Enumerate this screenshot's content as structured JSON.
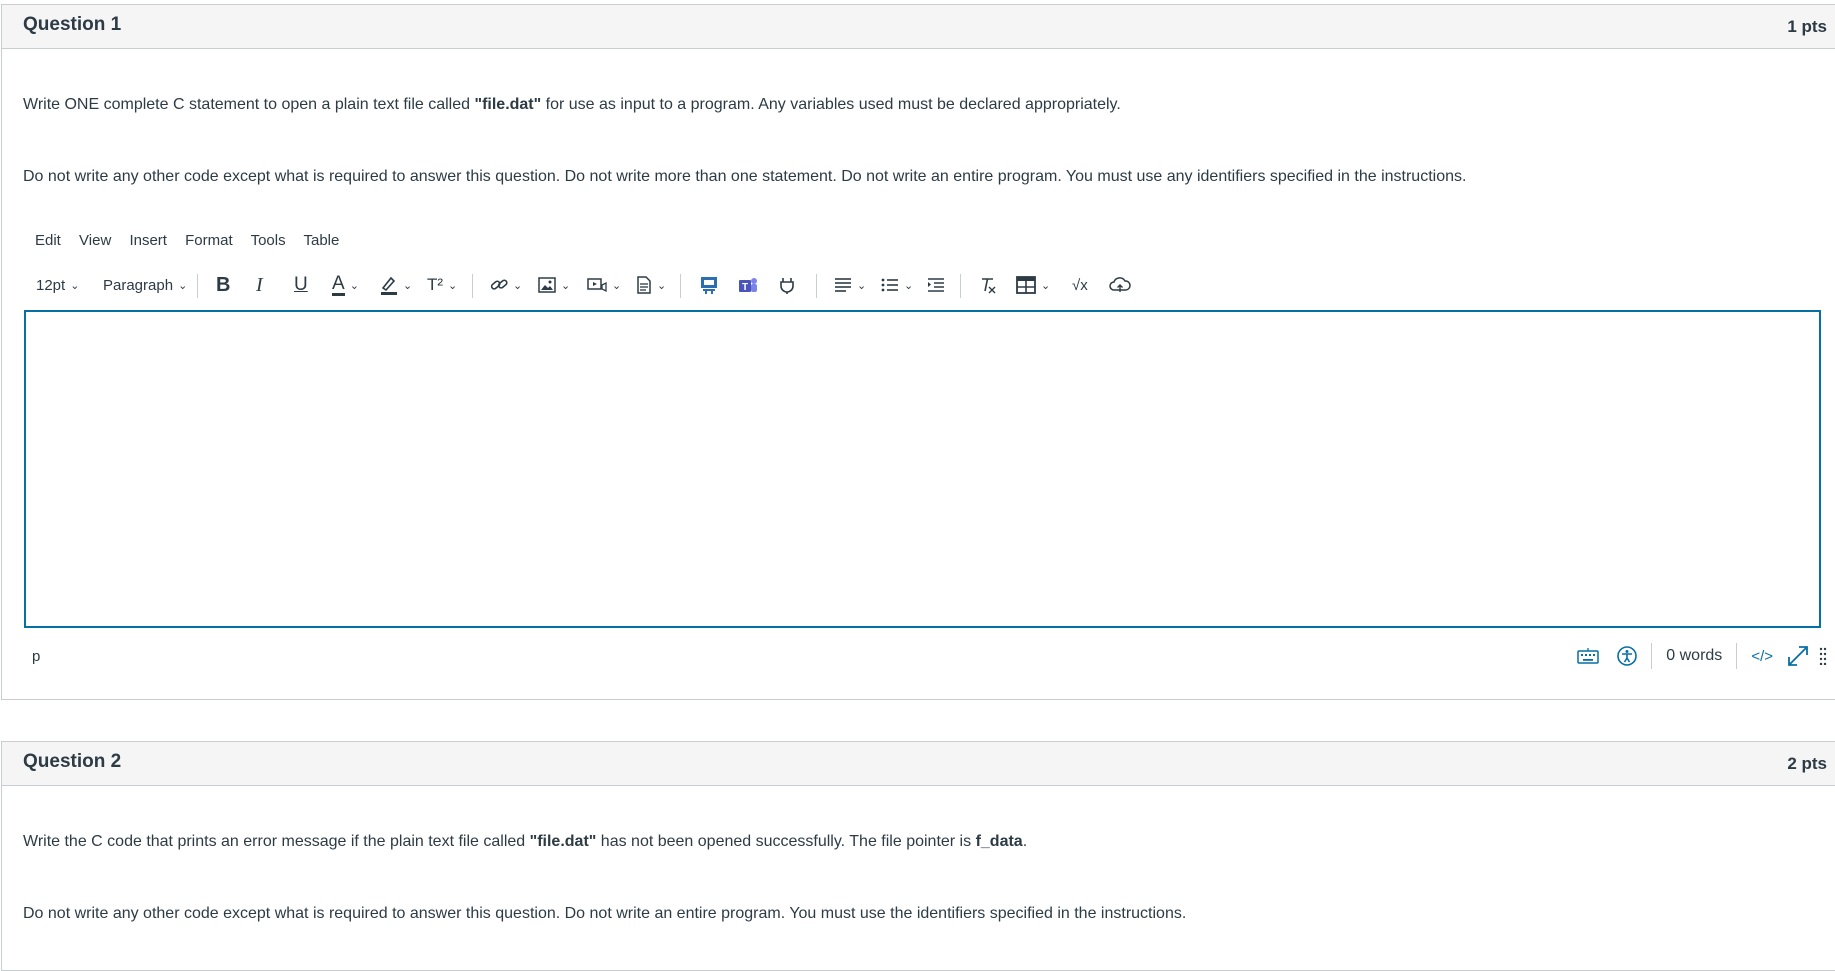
{
  "questions": [
    {
      "title": "Question 1",
      "points": "1 pts",
      "para1": {
        "before": "Write ONE complete C statement to open a plain text file called ",
        "bold": "\"file.dat\"",
        "after": " for use as input to a program. Any variables used must be declared appropriately."
      },
      "para2": "Do not write any other code except what is required to answer this question. Do not write more than one statement. Do not write an entire program. You must use any identifiers specified in the instructions."
    },
    {
      "title": "Question 2",
      "points": "2 pts",
      "para1": {
        "before": "Write the C code that prints an error message if the plain text file called ",
        "bold": "\"file.dat\"",
        "middle": " has not been opened successfully. The file pointer is ",
        "bold2": "f_data",
        "after": "."
      },
      "para2": "Do not write any other code except what is required to answer this question. Do not write an entire program. You must use the identifiers specified in the instructions."
    }
  ],
  "editor": {
    "menu": [
      "Edit",
      "View",
      "Insert",
      "Format",
      "Tools",
      "Table"
    ],
    "font_size": "12pt",
    "block_format": "Paragraph",
    "content": "",
    "status_path": "p",
    "word_count": "0 words",
    "html_toggle": "</>",
    "icons": {
      "bold": "bold-icon",
      "italic": "italic-icon",
      "underline": "underline-icon",
      "text_color": "text-color-icon",
      "highlight": "highlight-icon",
      "superscript": "superscript-icon",
      "link": "link-icon",
      "image": "image-icon",
      "media": "media-icon",
      "document": "document-icon",
      "apps": "apps-icon",
      "teams": "teams-icon",
      "plugin": "plugin-icon",
      "align": "align-icon",
      "list": "list-icon",
      "indent": "indent-icon",
      "clear_format": "clear-formatting-icon",
      "table": "table-icon",
      "math": "math-icon",
      "cloud": "cloud-icon",
      "keyboard": "keyboard-icon",
      "accessibility": "accessibility-icon",
      "fullscreen": "fullscreen-icon",
      "resize": "resize-handle-icon"
    },
    "accent_color": "#0770a3"
  }
}
